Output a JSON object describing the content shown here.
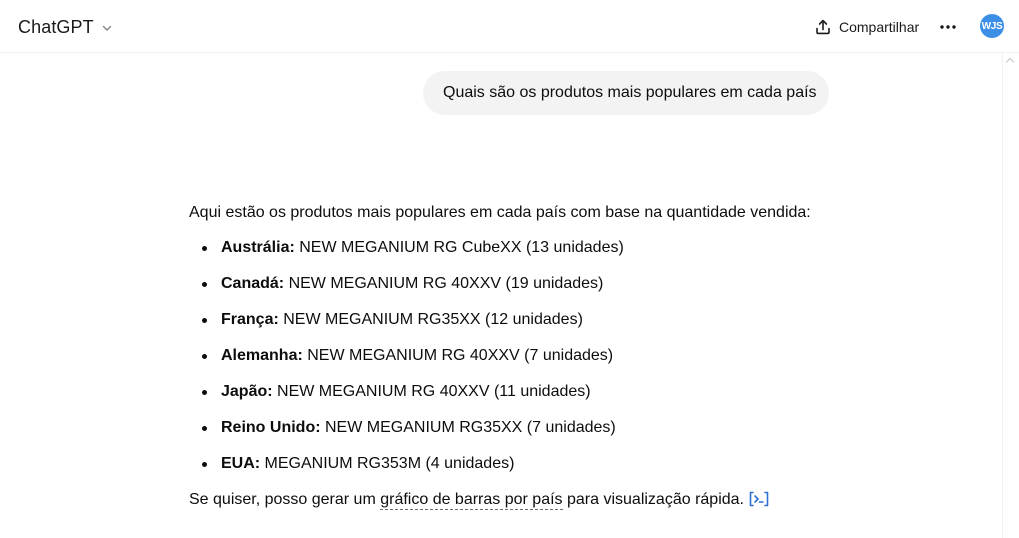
{
  "header": {
    "model_name": "ChatGPT",
    "share_label": "Compartilhar",
    "avatar_initials": "WJS",
    "avatar_color": "#3b8fe6"
  },
  "conversation": {
    "user_message": "Quais são os produtos mais populares em cada país",
    "assistant": {
      "intro": "Aqui estão os produtos mais populares em cada país com base na quantidade vendida:",
      "items": [
        {
          "country": "Austrália:",
          "product": " NEW MEGANIUM RG CubeXX (13 unidades)"
        },
        {
          "country": "Canadá:",
          "product": " NEW MEGANIUM RG 40XXV (19 unidades)"
        },
        {
          "country": "França:",
          "product": " NEW MEGANIUM RG35XX (12 unidades)"
        },
        {
          "country": "Alemanha:",
          "product": " NEW MEGANIUM RG 40XXV (7 unidades)"
        },
        {
          "country": "Japão:",
          "product": " NEW MEGANIUM RG 40XXV (11 unidades)"
        },
        {
          "country": "Reino Unido:",
          "product": " NEW MEGANIUM RG35XX (7 unidades)"
        },
        {
          "country": "EUA:",
          "product": " MEGANIUM RG353M (4 unidades)"
        }
      ],
      "outro_before": "Se quiser, posso gerar um ",
      "outro_link": "gráfico de barras por país",
      "outro_after": " para visualização rápida."
    }
  },
  "icons": {
    "model_menu": "chevron-down-icon",
    "share": "share-upload-icon",
    "more": "more-horizontal-icon",
    "code": "code-interpreter-icon",
    "scroll_up": "scroll-up-arrow-icon"
  }
}
